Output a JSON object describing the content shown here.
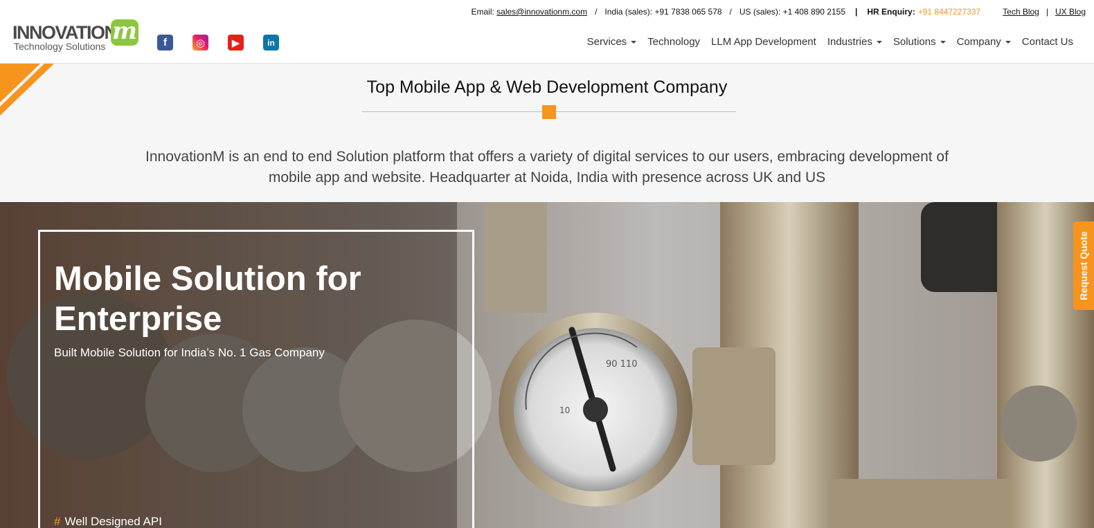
{
  "topbar": {
    "email_label": "Email:",
    "email": "sales@innovationm.com",
    "india_sales": "India (sales): +91 7838 065 578",
    "us_sales": "US (sales): +1 408 890 2155",
    "hr_label": "HR Enquiry:",
    "hr_phone": "+91 8447227337",
    "tech_blog": "Tech Blog",
    "ux_blog": "UX Blog"
  },
  "logo": {
    "brand": "INNOVATION",
    "mark": "m",
    "tagline": "Technology Solutions"
  },
  "social": [
    {
      "name": "facebook-icon",
      "glyph": "f"
    },
    {
      "name": "instagram-icon",
      "glyph": "◎"
    },
    {
      "name": "youtube-icon",
      "glyph": "▶"
    },
    {
      "name": "linkedin-icon",
      "glyph": "in"
    }
  ],
  "nav": {
    "services": "Services",
    "technology": "Technology",
    "llm": "LLM App Development",
    "industries": "Industries",
    "solutions": "Solutions",
    "company": "Company",
    "contact": "Contact Us"
  },
  "intro": {
    "title": "Top Mobile App & Web Development Company",
    "text": "InnovationM is an end to end Solution platform that offers a variety of digital services to our users, embracing development of mobile app and website. Headquarter at Noida, India with presence across UK and US"
  },
  "hero": {
    "title": "Mobile Solution for Enterprise",
    "subtitle": "Built Mobile Solution for India’s No. 1 Gas Company",
    "feature_hash": "#",
    "feature": "Well Designed API"
  },
  "request_quote": "Request Quote",
  "colors": {
    "accent": "#f7941d",
    "logo_green": "#8cc63f"
  }
}
